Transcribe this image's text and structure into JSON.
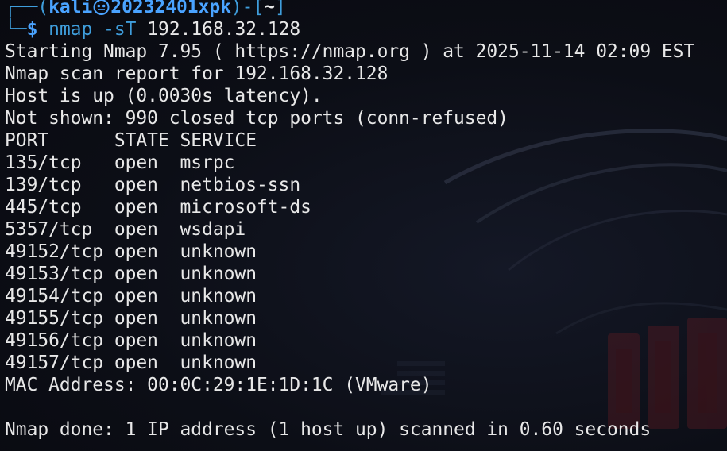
{
  "prompt": {
    "box_top_open": "┌──(",
    "user": "kali",
    "host": "20232401xpk",
    "box_mid": ")-[",
    "cwd": "~",
    "box_close": "]",
    "box_bottom": "└─",
    "symbol": "$",
    "command": "nmap",
    "option": "-sT",
    "target": "192.168.32.128"
  },
  "output": [
    "Starting Nmap 7.95 ( https://nmap.org ) at 2025-11-14 02:09 EST",
    "Nmap scan report for 192.168.32.128",
    "Host is up (0.0030s latency).",
    "Not shown: 990 closed tcp ports (conn-refused)",
    "PORT      STATE SERVICE",
    "135/tcp   open  msrpc",
    "139/tcp   open  netbios-ssn",
    "445/tcp   open  microsoft-ds",
    "5357/tcp  open  wsdapi",
    "49152/tcp open  unknown",
    "49153/tcp open  unknown",
    "49154/tcp open  unknown",
    "49155/tcp open  unknown",
    "49156/tcp open  unknown",
    "49157/tcp open  unknown",
    "MAC Address: 00:0C:29:1E:1D:1C (VMware)",
    "",
    "Nmap done: 1 IP address (1 host up) scanned in 0.60 seconds"
  ],
  "colors": {
    "prompt_accent": "#3f9edc",
    "user_host": "#4aa3ff",
    "text": "#e8e8e8",
    "background": "#0b0d14"
  },
  "icons": {
    "prompt_separator": "kali-skull-icon"
  }
}
